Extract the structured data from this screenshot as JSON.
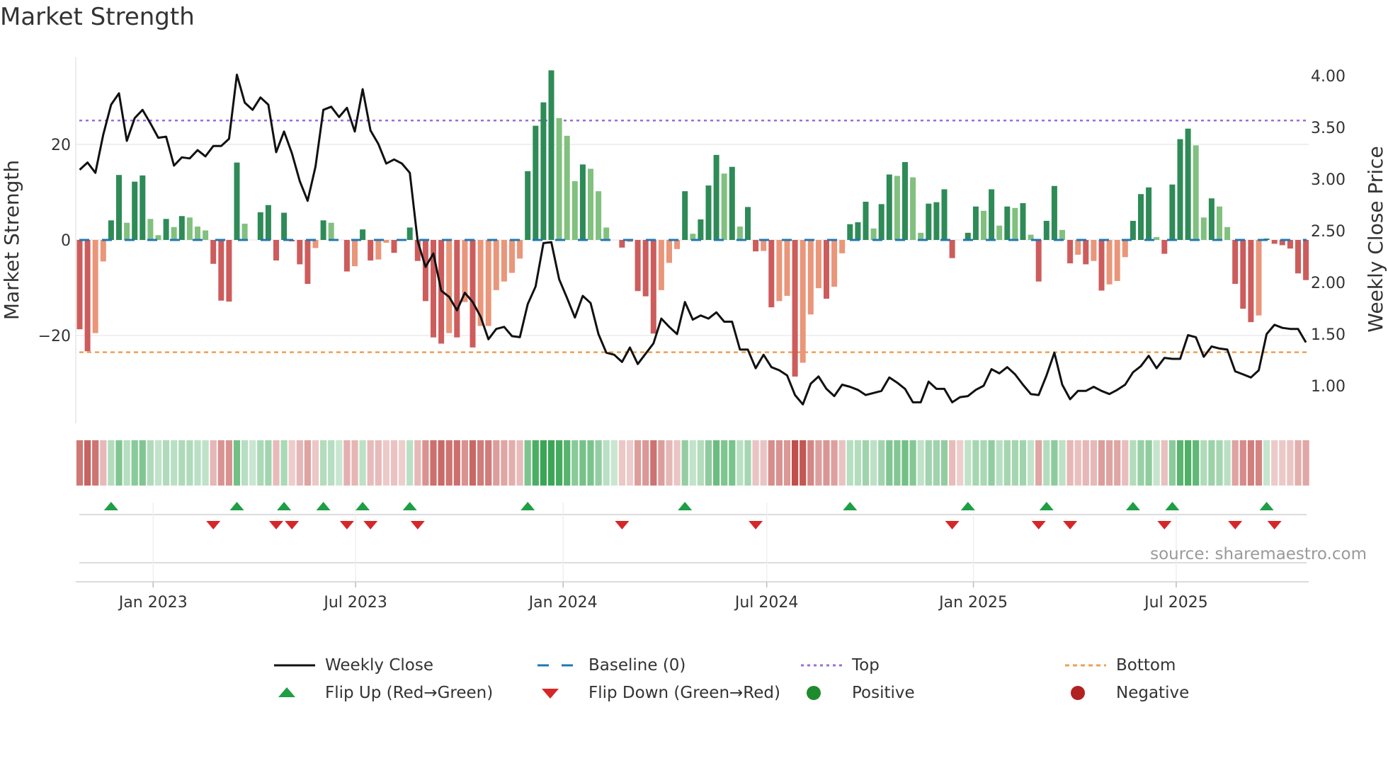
{
  "title": "Market Strength",
  "source": "source: sharemaestro.com",
  "colors": {
    "strong_green": "#2e8b57",
    "fading_green": "#82c07f",
    "strong_red": "#cd5c5c",
    "fading_red": "#e9967a",
    "top": "#9b6ddb",
    "bottom": "#f0a050",
    "baseline": "#1f77b4",
    "flip_up": "#1e9e45",
    "flip_down": "#d62728",
    "positive": "#1e8c2e",
    "negative": "#b22222",
    "close": "#111111"
  },
  "legend": [
    {
      "label": "Weekly Close",
      "icon": "solid-line"
    },
    {
      "label": "Baseline (0)",
      "icon": "dashed-line"
    },
    {
      "label": "Top",
      "icon": "dotted-line"
    },
    {
      "label": "Bottom",
      "icon": "dashed-line"
    },
    {
      "label": "Flip Up (Red→Green)",
      "icon": "triangle-up"
    },
    {
      "label": "Flip Down (Green→Red)",
      "icon": "triangle-down"
    },
    {
      "label": "Positive",
      "icon": "circle"
    },
    {
      "label": "Negative",
      "icon": "circle"
    }
  ],
  "chart_data": {
    "type": "bar",
    "title": "Market Strength",
    "ylabel": "Market Strength",
    "y2label": "Weekly Close Price",
    "ylim": [
      -38.3,
      38.2
    ],
    "y2lim": [
      0.64,
      4.18
    ],
    "yticks": [
      {
        "v": 20,
        "label": "20"
      },
      {
        "v": 0,
        "label": "0"
      },
      {
        "v": -20,
        "label": "−20"
      }
    ],
    "y2ticks": [
      {
        "v": 4.0,
        "label": "4.00"
      },
      {
        "v": 3.5,
        "label": "3.50"
      },
      {
        "v": 3.0,
        "label": "3.00"
      },
      {
        "v": 2.5,
        "label": "2.50"
      },
      {
        "v": 2.0,
        "label": "2.00"
      },
      {
        "v": 1.5,
        "label": "1.50"
      },
      {
        "v": 1.0,
        "label": "1.00"
      }
    ],
    "xticks": [
      {
        "v": 9.35,
        "label": "Jan 2023"
      },
      {
        "v": 35.1,
        "label": "Jul 2023"
      },
      {
        "v": 61.5,
        "label": "Jan 2024"
      },
      {
        "v": 87.4,
        "label": "Jul 2024"
      },
      {
        "v": 113.7,
        "label": "Jan 2025"
      },
      {
        "v": 139.5,
        "label": "Jul 2025"
      }
    ],
    "x_unit": "week index",
    "grid": true,
    "top_level": 25.0,
    "bottom_level": -23.5,
    "baseline": 0,
    "strength": [
      -18.7,
      -23.3,
      -19.5,
      -4.5,
      4.1,
      13.6,
      3.6,
      12.2,
      13.5,
      4.4,
      1.0,
      4.4,
      2.7,
      5.0,
      4.7,
      2.8,
      2.0,
      -5.0,
      -12.7,
      -12.9,
      16.2,
      3.4,
      0,
      5.8,
      7.3,
      -4.3,
      5.7,
      -0.3,
      -5.1,
      -9.2,
      -1.7,
      4.1,
      3.6,
      0,
      -6.6,
      -5.5,
      2.2,
      -4.3,
      -4.1,
      -0.6,
      -2.7,
      0,
      2.6,
      -4.4,
      -12.8,
      -20.4,
      -21.7,
      -19.5,
      -20.4,
      -13.0,
      -22.5,
      -18.0,
      -18.0,
      -10.5,
      -8.7,
      -6.9,
      -3.9,
      14.4,
      23.9,
      28.8,
      35.5,
      25.5,
      21.8,
      12.3,
      15.8,
      14.9,
      10.2,
      2.6,
      0,
      -1.6,
      -0.4,
      -10.7,
      -11.8,
      -19.6,
      -10.5,
      -4.8,
      -1.9,
      10.2,
      1.3,
      4.3,
      11.4,
      17.8,
      13.9,
      15.3,
      2.8,
      6.9,
      -2.4,
      -2.3,
      -14.1,
      -12.8,
      -11.7,
      -28.6,
      -25.7,
      -15.6,
      -10.1,
      -12.3,
      -9.8,
      -2.8,
      3.3,
      3.7,
      8.0,
      2.4,
      7.5,
      13.7,
      13.4,
      16.3,
      13.1,
      1.5,
      7.6,
      7.9,
      10.6,
      -3.8,
      0,
      1.5,
      7.0,
      6.1,
      10.6,
      3.0,
      7.0,
      6.7,
      7.7,
      1.1,
      -8.7,
      4.0,
      11.3,
      2.1,
      -4.9,
      -3.1,
      -5.1,
      -4.4,
      -10.6,
      -9.3,
      -8.6,
      -3.6,
      4.0,
      9.6,
      11.0,
      0.6,
      -2.9,
      11.6,
      21.1,
      23.3,
      19.8,
      4.7,
      8.7,
      7.0,
      2.7,
      -9.2,
      -14.4,
      -17.2,
      -15.8,
      0.3,
      -0.8,
      -1.1,
      -1.8,
      -7.0,
      -8.4
    ],
    "shade": "RRrrGGgGGggGgGgggRRRGgzGGRGRRRrGgzRrGRrrRzGRRRRrRrRrrrrrrGGGGgggGgggzRrRRRrrrGgGGGgGgGRrRrrRrrrRrrGGGgGGgGggGGGRzGGgGgGgGgRGGgRrRrRrrrGGGgRGGGggGggRRRrGRRRRR",
    "weekly_close": [
      3.09,
      3.16,
      3.06,
      3.43,
      3.72,
      3.83,
      3.37,
      3.59,
      3.67,
      3.54,
      3.4,
      3.41,
      3.13,
      3.21,
      3.2,
      3.28,
      3.22,
      3.32,
      3.32,
      3.39,
      4.01,
      3.74,
      3.67,
      3.79,
      3.72,
      3.26,
      3.46,
      3.25,
      2.98,
      2.79,
      3.12,
      3.67,
      3.7,
      3.6,
      3.69,
      3.46,
      3.87,
      3.47,
      3.34,
      3.15,
      3.19,
      3.15,
      3.06,
      2.4,
      2.15,
      2.28,
      1.92,
      1.86,
      1.73,
      1.9,
      1.81,
      1.67,
      1.45,
      1.55,
      1.57,
      1.48,
      1.47,
      1.79,
      1.96,
      2.38,
      2.39,
      2.03,
      1.85,
      1.66,
      1.87,
      1.8,
      1.5,
      1.32,
      1.3,
      1.23,
      1.37,
      1.21,
      1.31,
      1.41,
      1.65,
      1.57,
      1.5,
      1.81,
      1.64,
      1.68,
      1.65,
      1.71,
      1.62,
      1.62,
      1.35,
      1.35,
      1.17,
      1.3,
      1.18,
      1.15,
      1.1,
      0.91,
      0.82,
      1.02,
      1.09,
      0.97,
      0.9,
      1.01,
      0.99,
      0.96,
      0.91,
      0.93,
      0.95,
      1.08,
      1.03,
      0.97,
      0.84,
      0.84,
      1.04,
      0.97,
      0.97,
      0.84,
      0.89,
      0.9,
      0.96,
      1.0,
      1.16,
      1.12,
      1.18,
      1.11,
      1.01,
      0.92,
      0.91,
      1.1,
      1.32,
      1.01,
      0.87,
      0.95,
      0.95,
      0.99,
      0.95,
      0.92,
      0.96,
      1.01,
      1.13,
      1.19,
      1.29,
      1.17,
      1.27,
      1.26,
      1.26,
      1.49,
      1.47,
      1.28,
      1.38,
      1.36,
      1.35,
      1.14,
      1.11,
      1.08,
      1.15,
      1.5,
      1.59,
      1.56,
      1.55,
      1.55,
      1.42
    ],
    "flip_up": [
      4,
      20,
      26,
      31,
      36,
      42,
      57,
      77,
      98,
      113,
      123,
      134,
      139,
      151
    ],
    "flip_down": [
      17,
      25,
      27,
      34,
      37,
      43,
      69,
      86,
      111,
      122,
      126,
      138,
      147,
      152
    ]
  }
}
